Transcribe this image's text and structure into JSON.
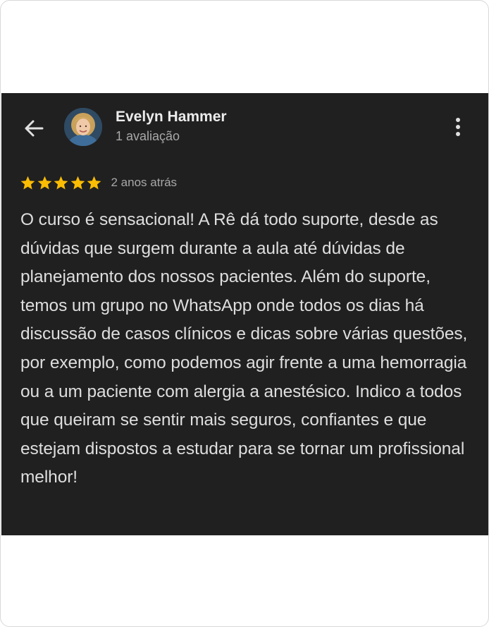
{
  "review": {
    "reviewer_name": "Evelyn Hammer",
    "review_count": "1 avaliação",
    "rating": 5,
    "rating_max": 5,
    "date": "2 anos atrás",
    "text": "O curso é sensacional! A Rê dá todo suporte, desde as dúvidas que surgem durante a aula até dúvidas de planejamento dos nossos pacientes. Além do suporte, temos um grupo no WhatsApp onde todos os dias há discussão de casos clínicos e dicas sobre várias questões, por exemplo, como podemos agir frente a uma hemorragia ou a um paciente com alergia a anestésico. Indico a todos que queiram se sentir mais seguros, confiantes e que estejam dispostos a estudar para se tornar um profissional melhor!"
  },
  "icons": {
    "back": "arrow-left-icon",
    "more": "more-vertical-icon",
    "star": "star-icon"
  },
  "colors": {
    "background": "#202020",
    "star": "#fbbc04",
    "primary_text": "#ececec",
    "secondary_text": "#a8a8a8"
  }
}
